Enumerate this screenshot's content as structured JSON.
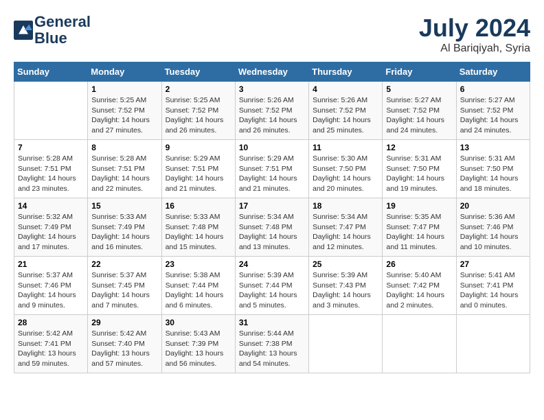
{
  "header": {
    "logo_line1": "General",
    "logo_line2": "Blue",
    "month_year": "July 2024",
    "location": "Al Bariqiyah, Syria"
  },
  "weekdays": [
    "Sunday",
    "Monday",
    "Tuesday",
    "Wednesday",
    "Thursday",
    "Friday",
    "Saturday"
  ],
  "weeks": [
    [
      {
        "day": "",
        "info": ""
      },
      {
        "day": "1",
        "info": "Sunrise: 5:25 AM\nSunset: 7:52 PM\nDaylight: 14 hours\nand 27 minutes."
      },
      {
        "day": "2",
        "info": "Sunrise: 5:25 AM\nSunset: 7:52 PM\nDaylight: 14 hours\nand 26 minutes."
      },
      {
        "day": "3",
        "info": "Sunrise: 5:26 AM\nSunset: 7:52 PM\nDaylight: 14 hours\nand 26 minutes."
      },
      {
        "day": "4",
        "info": "Sunrise: 5:26 AM\nSunset: 7:52 PM\nDaylight: 14 hours\nand 25 minutes."
      },
      {
        "day": "5",
        "info": "Sunrise: 5:27 AM\nSunset: 7:52 PM\nDaylight: 14 hours\nand 24 minutes."
      },
      {
        "day": "6",
        "info": "Sunrise: 5:27 AM\nSunset: 7:52 PM\nDaylight: 14 hours\nand 24 minutes."
      }
    ],
    [
      {
        "day": "7",
        "info": "Sunrise: 5:28 AM\nSunset: 7:51 PM\nDaylight: 14 hours\nand 23 minutes."
      },
      {
        "day": "8",
        "info": "Sunrise: 5:28 AM\nSunset: 7:51 PM\nDaylight: 14 hours\nand 22 minutes."
      },
      {
        "day": "9",
        "info": "Sunrise: 5:29 AM\nSunset: 7:51 PM\nDaylight: 14 hours\nand 21 minutes."
      },
      {
        "day": "10",
        "info": "Sunrise: 5:29 AM\nSunset: 7:51 PM\nDaylight: 14 hours\nand 21 minutes."
      },
      {
        "day": "11",
        "info": "Sunrise: 5:30 AM\nSunset: 7:50 PM\nDaylight: 14 hours\nand 20 minutes."
      },
      {
        "day": "12",
        "info": "Sunrise: 5:31 AM\nSunset: 7:50 PM\nDaylight: 14 hours\nand 19 minutes."
      },
      {
        "day": "13",
        "info": "Sunrise: 5:31 AM\nSunset: 7:50 PM\nDaylight: 14 hours\nand 18 minutes."
      }
    ],
    [
      {
        "day": "14",
        "info": "Sunrise: 5:32 AM\nSunset: 7:49 PM\nDaylight: 14 hours\nand 17 minutes."
      },
      {
        "day": "15",
        "info": "Sunrise: 5:33 AM\nSunset: 7:49 PM\nDaylight: 14 hours\nand 16 minutes."
      },
      {
        "day": "16",
        "info": "Sunrise: 5:33 AM\nSunset: 7:48 PM\nDaylight: 14 hours\nand 15 minutes."
      },
      {
        "day": "17",
        "info": "Sunrise: 5:34 AM\nSunset: 7:48 PM\nDaylight: 14 hours\nand 13 minutes."
      },
      {
        "day": "18",
        "info": "Sunrise: 5:34 AM\nSunset: 7:47 PM\nDaylight: 14 hours\nand 12 minutes."
      },
      {
        "day": "19",
        "info": "Sunrise: 5:35 AM\nSunset: 7:47 PM\nDaylight: 14 hours\nand 11 minutes."
      },
      {
        "day": "20",
        "info": "Sunrise: 5:36 AM\nSunset: 7:46 PM\nDaylight: 14 hours\nand 10 minutes."
      }
    ],
    [
      {
        "day": "21",
        "info": "Sunrise: 5:37 AM\nSunset: 7:46 PM\nDaylight: 14 hours\nand 9 minutes."
      },
      {
        "day": "22",
        "info": "Sunrise: 5:37 AM\nSunset: 7:45 PM\nDaylight: 14 hours\nand 7 minutes."
      },
      {
        "day": "23",
        "info": "Sunrise: 5:38 AM\nSunset: 7:44 PM\nDaylight: 14 hours\nand 6 minutes."
      },
      {
        "day": "24",
        "info": "Sunrise: 5:39 AM\nSunset: 7:44 PM\nDaylight: 14 hours\nand 5 minutes."
      },
      {
        "day": "25",
        "info": "Sunrise: 5:39 AM\nSunset: 7:43 PM\nDaylight: 14 hours\nand 3 minutes."
      },
      {
        "day": "26",
        "info": "Sunrise: 5:40 AM\nSunset: 7:42 PM\nDaylight: 14 hours\nand 2 minutes."
      },
      {
        "day": "27",
        "info": "Sunrise: 5:41 AM\nSunset: 7:41 PM\nDaylight: 14 hours\nand 0 minutes."
      }
    ],
    [
      {
        "day": "28",
        "info": "Sunrise: 5:42 AM\nSunset: 7:41 PM\nDaylight: 13 hours\nand 59 minutes."
      },
      {
        "day": "29",
        "info": "Sunrise: 5:42 AM\nSunset: 7:40 PM\nDaylight: 13 hours\nand 57 minutes."
      },
      {
        "day": "30",
        "info": "Sunrise: 5:43 AM\nSunset: 7:39 PM\nDaylight: 13 hours\nand 56 minutes."
      },
      {
        "day": "31",
        "info": "Sunrise: 5:44 AM\nSunset: 7:38 PM\nDaylight: 13 hours\nand 54 minutes."
      },
      {
        "day": "",
        "info": ""
      },
      {
        "day": "",
        "info": ""
      },
      {
        "day": "",
        "info": ""
      }
    ]
  ]
}
